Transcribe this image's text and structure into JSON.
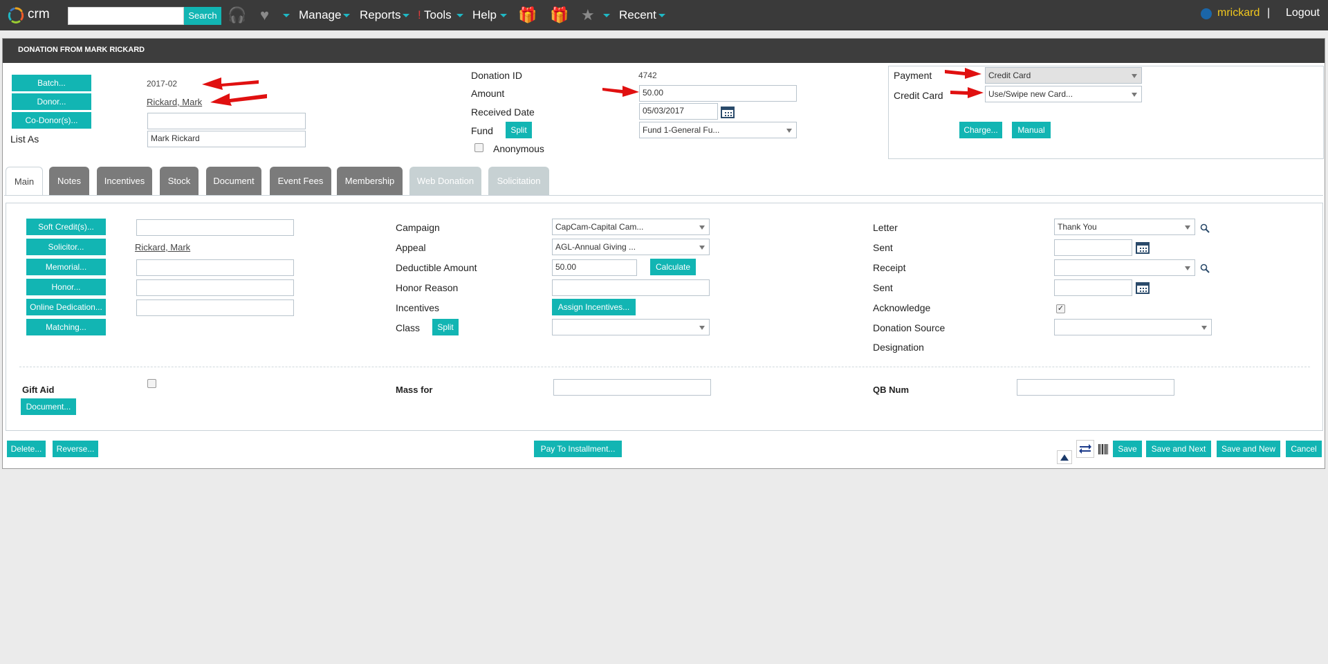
{
  "nav": {
    "logo_text": "crm",
    "search_button": "Search",
    "menus": {
      "manage": "Manage",
      "reports": "Reports",
      "tools_bang": "!",
      "tools": "Tools",
      "help": "Help",
      "recent": "Recent"
    },
    "user": "mrickard",
    "separator": "|",
    "logout": "Logout"
  },
  "panel": {
    "title": "DONATION FROM MARK RICKARD",
    "top_left": {
      "batch_button": "Batch...",
      "batch_value": "2017-02",
      "donor_button": "Donor...",
      "donor_value": "Rickard, Mark",
      "codonor_button": "Co-Donor(s)...",
      "codonor_value": "",
      "list_as_label": "List As",
      "list_as_value": "Mark Rickard"
    },
    "top_middle": {
      "donation_id_label": "Donation ID",
      "donation_id_value": "4742",
      "amount_label": "Amount",
      "amount_value": "50.00",
      "received_label": "Received Date",
      "received_value": "05/03/2017",
      "fund_label": "Fund",
      "split_button": "Split",
      "fund_value": "Fund 1-General Fu...",
      "anonymous_label": "Anonymous"
    },
    "top_right": {
      "payment_label": "Payment",
      "payment_value": "Credit Card",
      "credit_card_label": "Credit Card",
      "credit_card_value": "Use/Swipe new Card...",
      "charge_button": "Charge...",
      "manual_button": "Manual"
    },
    "tabs": [
      {
        "label": "Main"
      },
      {
        "label": "Notes"
      },
      {
        "label": "Incentives"
      },
      {
        "label": "Stock"
      },
      {
        "label": "Document"
      },
      {
        "label": "Event Fees"
      },
      {
        "label": "Membership"
      },
      {
        "label": "Web Donation"
      },
      {
        "label": "Solicitation"
      }
    ],
    "main": {
      "left_buttons": [
        "Soft Credit(s)...",
        "Solicitor...",
        "Memorial...",
        "Honor...",
        "Online Dedication...",
        "Matching..."
      ],
      "solicitor_value": "Rickard, Mark",
      "campaign_label": "Campaign",
      "campaign_value": "CapCam-Capital Cam...",
      "appeal_label": "Appeal",
      "appeal_value": "AGL-Annual Giving ...",
      "deductible_label": "Deductible Amount",
      "deductible_value": "50.00",
      "calculate_button": "Calculate",
      "honor_reason_label": "Honor Reason",
      "incentives_label": "Incentives",
      "assign_incentives_button": "Assign Incentives...",
      "class_label": "Class",
      "class_split_button": "Split",
      "letter_label": "Letter",
      "letter_value": "Thank You",
      "sent_label": "Sent",
      "receipt_label": "Receipt",
      "sent2_label": "Sent",
      "acknowledge_label": "Acknowledge",
      "donation_source_label": "Donation Source",
      "designation_label": "Designation",
      "gift_aid_label": "Gift Aid",
      "document_button": "Document...",
      "mass_for_label": "Mass for",
      "qb_num_label": "QB Num"
    },
    "footer": {
      "delete_button": "Delete...",
      "reverse_button": "Reverse...",
      "pay_installment_button": "Pay To Installment...",
      "save_button": "Save",
      "save_next_button": "Save and Next",
      "save_new_button": "Save and New",
      "cancel_button": "Cancel"
    }
  },
  "colors": {
    "accent": "#12b5b3",
    "nav_bg": "#3a3a3a",
    "user": "#f2c81e",
    "arrow": "#e01010"
  }
}
